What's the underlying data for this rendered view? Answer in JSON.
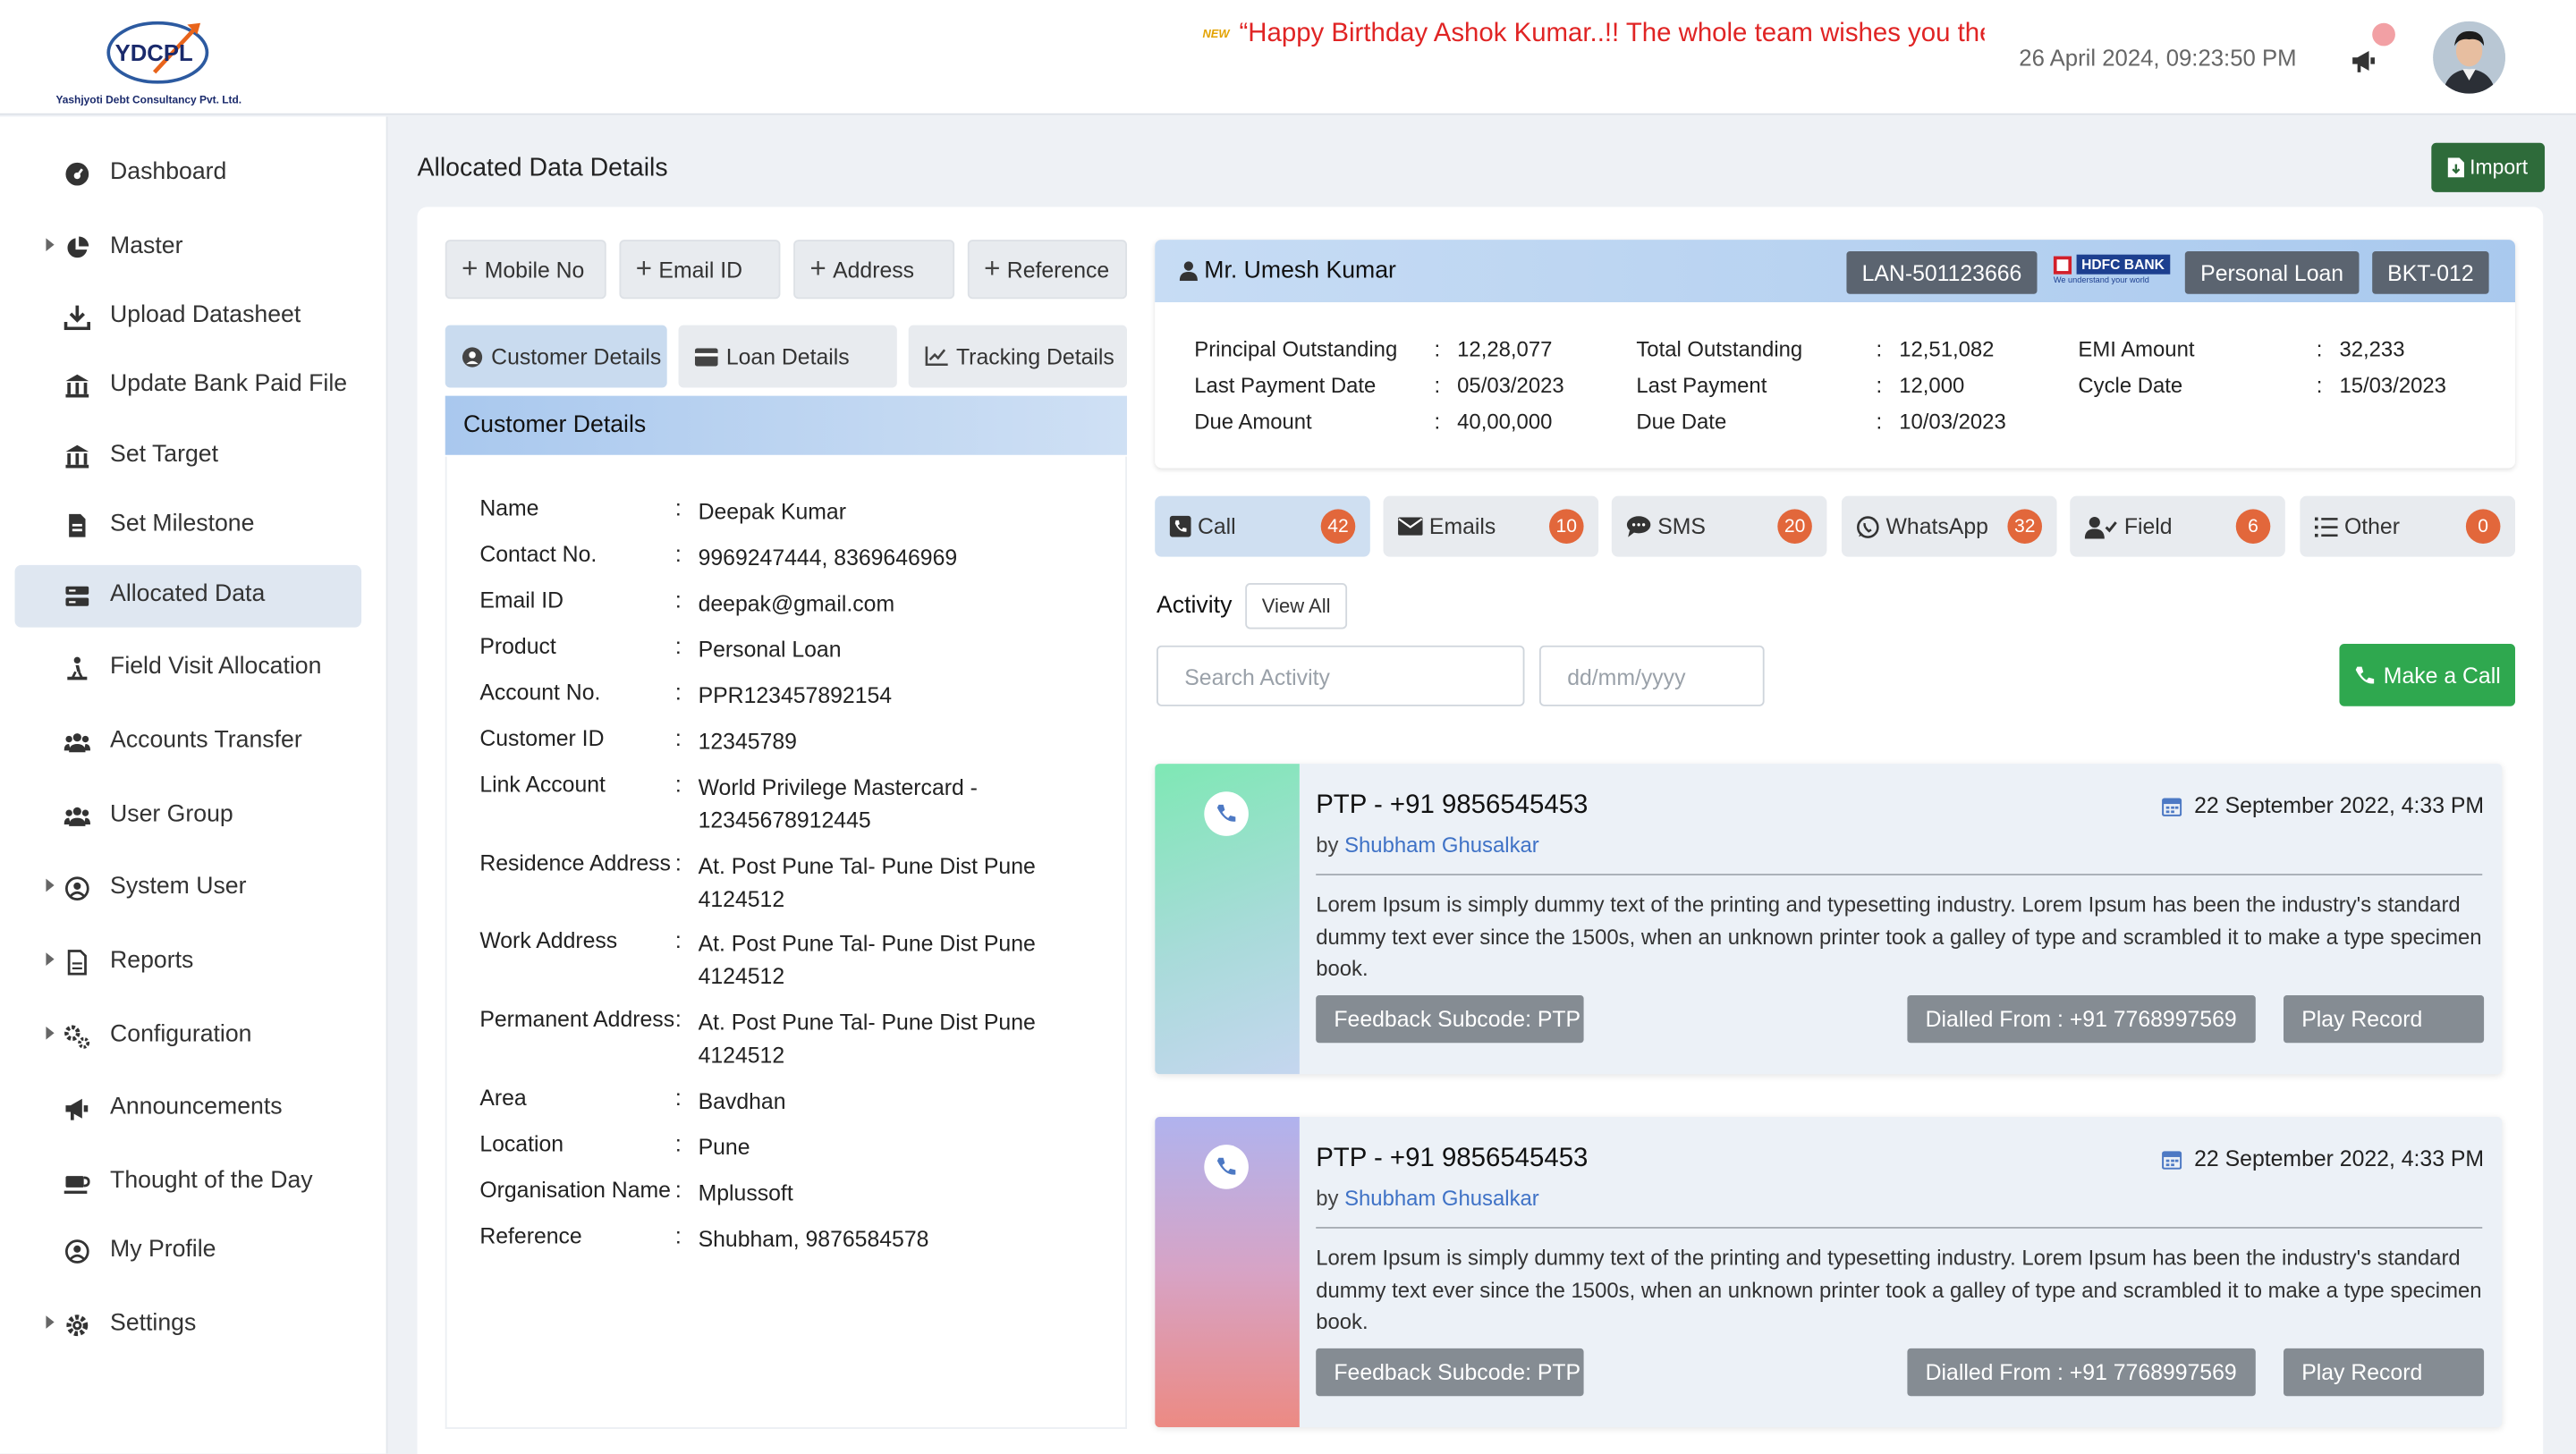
{
  "header": {
    "logo_text": "YDCPL",
    "company_name": "Yashjyoti Debt Consultancy Pvt. Ltd.",
    "ticker_badge": "NEW",
    "ticker_message": "“Happy Birthday Ashok Kumar..!! The whole team wishes you the ha",
    "datetime": "26 April 2024, 09:23:50 PM"
  },
  "sidebar": {
    "items": [
      {
        "label": "Dashboard"
      },
      {
        "label": "Master"
      },
      {
        "label": "Upload Datasheet"
      },
      {
        "label": "Update Bank Paid File"
      },
      {
        "label": "Set Target"
      },
      {
        "label": "Set Milestone"
      },
      {
        "label": "Allocated Data"
      },
      {
        "label": "Field Visit Allocation"
      },
      {
        "label": "Accounts Transfer"
      },
      {
        "label": "User Group"
      },
      {
        "label": "System User"
      },
      {
        "label": "Reports"
      },
      {
        "label": "Configuration"
      },
      {
        "label": "Announcements"
      },
      {
        "label": "Thought of the Day"
      },
      {
        "label": "My Profile"
      },
      {
        "label": "Settings"
      }
    ]
  },
  "page": {
    "title": "Allocated Data Details",
    "import_label": "Import"
  },
  "add_buttons": [
    "Mobile No",
    "Email ID",
    "Address",
    "Reference"
  ],
  "detail_tabs": [
    "Customer Details",
    "Loan Details",
    "Tracking Details"
  ],
  "customer_details": {
    "heading": "Customer Details",
    "rows": [
      {
        "key": "Name",
        "value": "Deepak Kumar"
      },
      {
        "key": "Contact No.",
        "value": "9969247444, 8369646969"
      },
      {
        "key": "Email ID",
        "value": "deepak@gmail.com"
      },
      {
        "key": "Product",
        "value": "Personal Loan"
      },
      {
        "key": "Account No.",
        "value": "PPR123457892154"
      },
      {
        "key": "Customer ID",
        "value": "12345789"
      },
      {
        "key": "Link Account",
        "value": "World Privilege Mastercard - 12345678912445"
      },
      {
        "key": "Residence Address",
        "value": "At. Post Pune Tal- Pune Dist Pune 4124512"
      },
      {
        "key": "Work Address",
        "value": "At. Post Pune Tal- Pune Dist Pune 4124512"
      },
      {
        "key": "Permanent Address",
        "value": "At. Post Pune Tal- Pune Dist Pune 4124512"
      },
      {
        "key": "Area",
        "value": "Bavdhan"
      },
      {
        "key": "Location",
        "value": "Pune"
      },
      {
        "key": "Organisation Name",
        "value": "Mplussoft"
      },
      {
        "key": "Reference",
        "value": "Shubham, 9876584578"
      }
    ]
  },
  "customer_card": {
    "name": "Mr. Umesh Kumar",
    "lan": "LAN-501123666",
    "bank_name": "HDFC BANK",
    "bank_tagline": "We understand your world",
    "product": "Personal Loan",
    "bucket": "BKT-012",
    "fields": [
      {
        "key": "Principal Outstanding",
        "value": "12,28,077"
      },
      {
        "key": "Last Payment Date",
        "value": "05/03/2023"
      },
      {
        "key": "Due Amount",
        "value": "40,00,000"
      },
      {
        "key": "Total Outstanding",
        "value": "12,51,082"
      },
      {
        "key": "Last Payment",
        "value": "12,000"
      },
      {
        "key": "Due Date",
        "value": "10/03/2023"
      },
      {
        "key": "EMI Amount",
        "value": "32,233"
      },
      {
        "key": "Cycle Date",
        "value": "15/03/2023"
      }
    ]
  },
  "channels": [
    {
      "label": "Call",
      "count": "42"
    },
    {
      "label": "Emails",
      "count": "10"
    },
    {
      "label": "SMS",
      "count": "20"
    },
    {
      "label": "WhatsApp",
      "count": "32"
    },
    {
      "label": "Field",
      "count": "6"
    },
    {
      "label": "Other",
      "count": "0"
    }
  ],
  "activity": {
    "label": "Activity",
    "view_all": "View All",
    "search_placeholder": "Search Activity",
    "date_placeholder": "dd/mm/yyyy",
    "make_call": "Make a Call",
    "items": [
      {
        "title": "PTP - +91 9856545453",
        "by_prefix": "by",
        "by_name": "Shubham Ghusalkar",
        "date": "22 September 2022, 4:33 PM",
        "description": "Lorem Ipsum is simply dummy text of the printing and typesetting industry. Lorem Ipsum has been the industry's standard dummy text ever since the 1500s, when an unknown printer took a galley of type and scrambled it to make a type specimen book.",
        "feedback": "Feedback Subcode: PTP",
        "dialled": "Dialled From : +91 7768997569",
        "play": "Play Record"
      },
      {
        "title": "PTP - +91 9856545453",
        "by_prefix": "by",
        "by_name": "Shubham Ghusalkar",
        "date": "22 September 2022, 4:33 PM",
        "description": "Lorem Ipsum is simply dummy text of the printing and typesetting industry. Lorem Ipsum has been the industry's standard dummy text ever since the 1500s, when an unknown printer took a galley of type and scrambled it to make a type specimen book.",
        "feedback": "Feedback Subcode: PTP",
        "dialled": "Dialled From : +91 7768997569",
        "play": "Play Record"
      }
    ]
  },
  "colors": {
    "accent_green": "#2fa84f",
    "badge_orange": "#e2673b",
    "active_blue": "#cfdff1",
    "ticker_red": "#e02424"
  }
}
